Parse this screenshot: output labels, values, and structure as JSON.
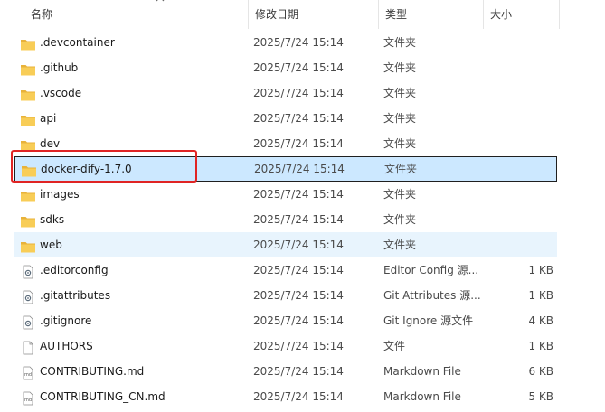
{
  "columns": {
    "name": "名称",
    "date": "修改日期",
    "type": "类型",
    "size": "大小"
  },
  "files": [
    {
      "name": ".devcontainer",
      "date": "2025/7/24 15:14",
      "type": "文件夹",
      "size": "",
      "icon": "folder-icon"
    },
    {
      "name": ".github",
      "date": "2025/7/24 15:14",
      "type": "文件夹",
      "size": "",
      "icon": "folder-icon"
    },
    {
      "name": ".vscode",
      "date": "2025/7/24 15:14",
      "type": "文件夹",
      "size": "",
      "icon": "folder-icon"
    },
    {
      "name": "api",
      "date": "2025/7/24 15:14",
      "type": "文件夹",
      "size": "",
      "icon": "folder-icon"
    },
    {
      "name": "dev",
      "date": "2025/7/24 15:14",
      "type": "文件夹",
      "size": "",
      "icon": "folder-icon"
    },
    {
      "name": "docker-dify-1.7.0",
      "date": "2025/7/24 15:14",
      "type": "文件夹",
      "size": "",
      "icon": "folder-icon"
    },
    {
      "name": "images",
      "date": "2025/7/24 15:14",
      "type": "文件夹",
      "size": "",
      "icon": "folder-icon"
    },
    {
      "name": "sdks",
      "date": "2025/7/24 15:14",
      "type": "文件夹",
      "size": "",
      "icon": "folder-icon"
    },
    {
      "name": "web",
      "date": "2025/7/24 15:14",
      "type": "文件夹",
      "size": "",
      "icon": "folder-icon"
    },
    {
      "name": ".editorconfig",
      "date": "2025/7/24 15:14",
      "type": "Editor Config 源...",
      "size": "1 KB",
      "icon": "config-file-icon"
    },
    {
      "name": ".gitattributes",
      "date": "2025/7/24 15:14",
      "type": "Git Attributes 源...",
      "size": "1 KB",
      "icon": "config-file-icon"
    },
    {
      "name": ".gitignore",
      "date": "2025/7/24 15:14",
      "type": "Git Ignore 源文件",
      "size": "4 KB",
      "icon": "config-file-icon"
    },
    {
      "name": "AUTHORS",
      "date": "2025/7/24 15:14",
      "type": "文件",
      "size": "1 KB",
      "icon": "blank-file-icon"
    },
    {
      "name": "CONTRIBUTING.md",
      "date": "2025/7/24 15:14",
      "type": "Markdown File",
      "size": "6 KB",
      "icon": "markdown-file-icon"
    },
    {
      "name": "CONTRIBUTING_CN.md",
      "date": "2025/7/24 15:14",
      "type": "Markdown File",
      "size": "5 KB",
      "icon": "markdown-file-icon"
    }
  ],
  "selected_index": 5,
  "hover_index": 8,
  "highlighted_index": 5,
  "colors": {
    "selection": "#cce8ff",
    "hover": "#e8f4fd",
    "highlight_border": "#e02424",
    "folder": "#f5c542"
  }
}
